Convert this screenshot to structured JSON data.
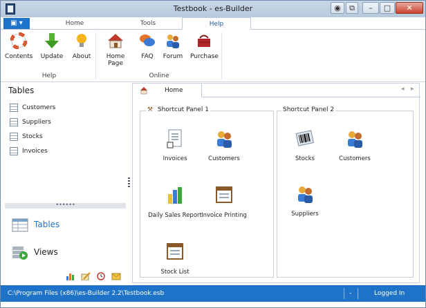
{
  "window": {
    "title": "Testbook - es-Builder"
  },
  "ribbon_tabs": [
    "Home",
    "Tools",
    "Help"
  ],
  "ribbon": {
    "help_group": {
      "label": "Help",
      "buttons": [
        "Contents",
        "Update",
        "About"
      ]
    },
    "online_group": {
      "label": "Online",
      "buttons": [
        "Home Page",
        "FAQ",
        "Forum",
        "Purchase"
      ]
    }
  },
  "left_panel": {
    "header": "Tables",
    "items": [
      "Customers",
      "Suppliers",
      "Stocks",
      "Invoices"
    ],
    "nav": [
      "Tables",
      "Views"
    ],
    "toolbar_icons": [
      "chart-icon",
      "edit-icon",
      "clock-icon",
      "mail-icon"
    ]
  },
  "document": {
    "tab": "Home",
    "panel1": {
      "title": "Shortcut Panel 1",
      "items": [
        "Invoices",
        "Customers",
        "Daily Sales Report",
        "Invoice Printing",
        "Stock List"
      ]
    },
    "panel2": {
      "title": "Shortcut Panel 2",
      "items": [
        "Stocks",
        "Customers",
        "Suppliers"
      ]
    }
  },
  "status_bar": {
    "path": "C:\\Program Files (x86)\\es-Builder 2.2\\Testbook.esb",
    "dash": "-",
    "state": "Logged In"
  },
  "colors": {
    "accent": "#1e73c8",
    "ribbon_active": "#1e5aa8"
  }
}
